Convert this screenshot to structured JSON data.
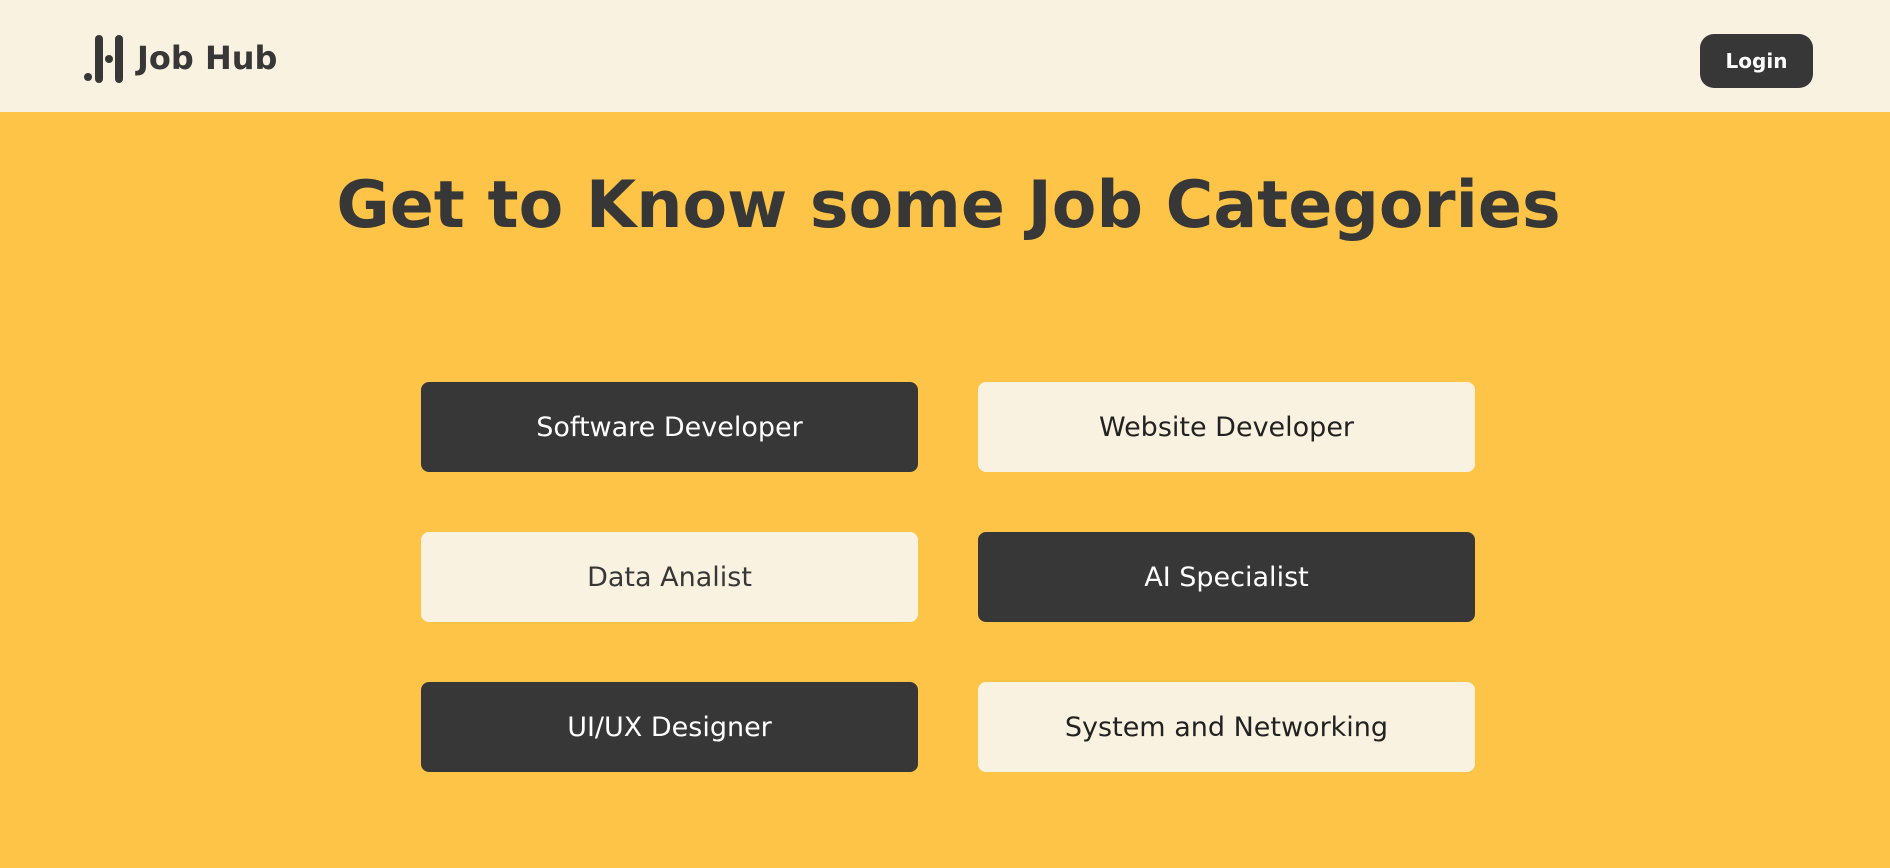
{
  "header": {
    "brand_name": "Job Hub",
    "logo_icon": "job-hub-logo-icon",
    "login_label": "Login"
  },
  "main": {
    "title": "Get to Know some Job Categories",
    "categories": [
      {
        "label": "Software Developer",
        "style": "dark"
      },
      {
        "label": "Website Developer",
        "style": "light"
      },
      {
        "label": "Data Analist",
        "style": "light"
      },
      {
        "label": "AI Specialist",
        "style": "dark"
      },
      {
        "label": "UI/UX Designer",
        "style": "dark"
      },
      {
        "label": "System and Networking",
        "style": "light"
      }
    ]
  },
  "colors": {
    "page_background": "#fec447",
    "header_background": "#faf2e1",
    "dark": "#373737",
    "light": "#faf2e1"
  }
}
